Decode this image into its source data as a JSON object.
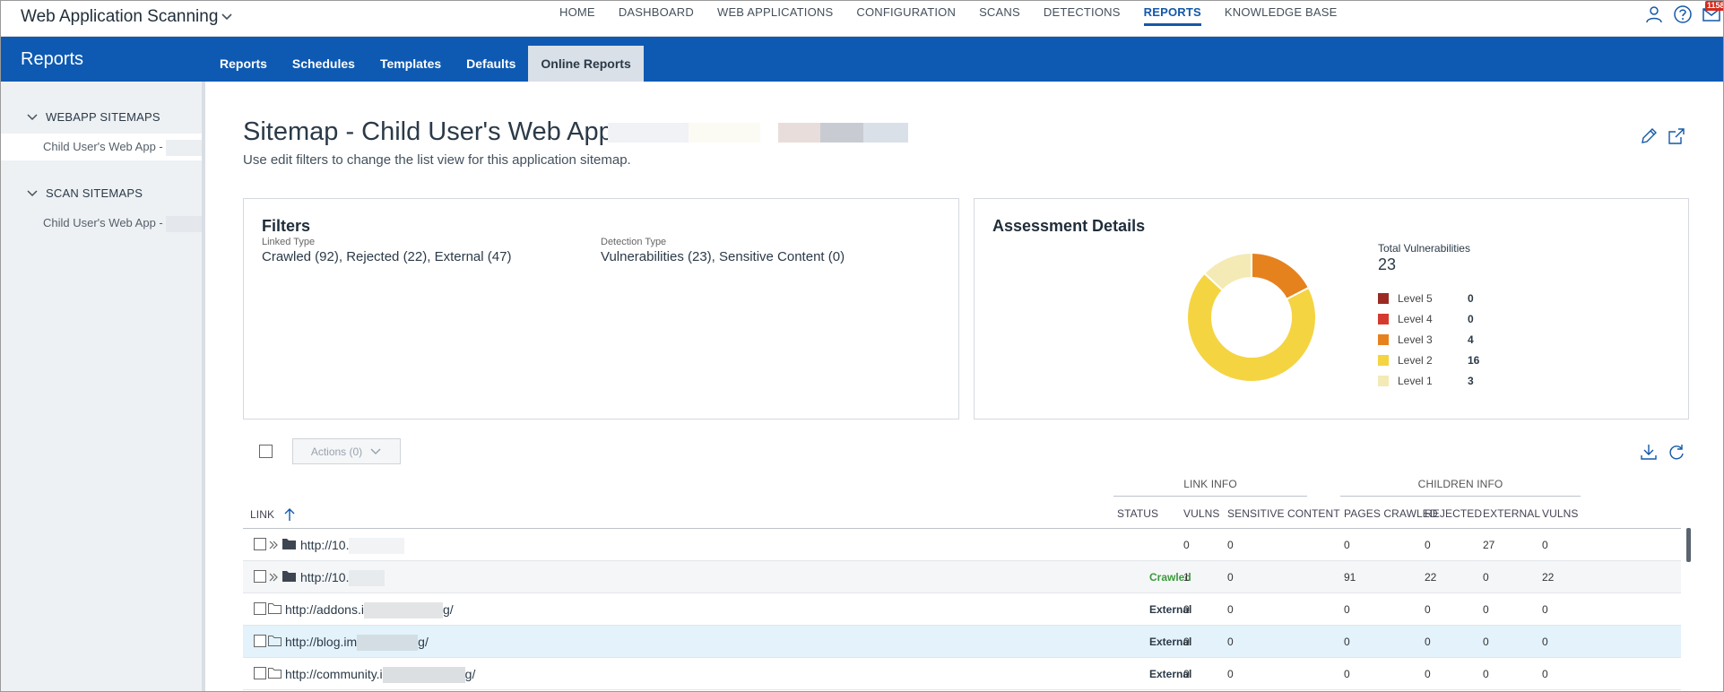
{
  "app": {
    "title": "Web Application Scanning"
  },
  "topnav": [
    {
      "label": "HOME",
      "active": false
    },
    {
      "label": "DASHBOARD",
      "active": false
    },
    {
      "label": "WEB APPLICATIONS",
      "active": false
    },
    {
      "label": "CONFIGURATION",
      "active": false
    },
    {
      "label": "SCANS",
      "active": false
    },
    {
      "label": "DETECTIONS",
      "active": false
    },
    {
      "label": "REPORTS",
      "active": true
    },
    {
      "label": "KNOWLEDGE BASE",
      "active": false
    }
  ],
  "top_icons": {
    "user": "user-icon",
    "help": "help-icon",
    "mail": "mail-icon",
    "mail_badge": "1158"
  },
  "band": {
    "title": "Reports",
    "tabs": [
      "Reports",
      "Schedules",
      "Templates",
      "Defaults",
      "Online Reports"
    ],
    "active_tab": "Online Reports"
  },
  "sidebar": {
    "groups": [
      {
        "label": "WEBAPP SITEMAPS",
        "items": [
          "Child User's Web App -"
        ]
      },
      {
        "label": "SCAN SITEMAPS",
        "items": [
          "Child User's Web App -"
        ]
      }
    ]
  },
  "page": {
    "title": "Sitemap - Child User's Web App -",
    "subtitle": "Use edit filters to change the list view for this application sitemap."
  },
  "filters": {
    "heading": "Filters",
    "linked_type_label": "Linked Type",
    "linked_type_value": "Crawled (92),  Rejected (22),  External (47)",
    "detection_type_label": "Detection Type",
    "detection_type_value": "Vulnerabilities (23), Sensitive Content (0)"
  },
  "assessment": {
    "heading": "Assessment Details",
    "total_label": "Total Vulnerabilities",
    "total_value": "23",
    "levels": [
      {
        "name": "Level 5",
        "value": 0,
        "color": "#9b2b22"
      },
      {
        "name": "Level 4",
        "value": 0,
        "color": "#d53a2e"
      },
      {
        "name": "Level 3",
        "value": 4,
        "color": "#e6821e"
      },
      {
        "name": "Level 2",
        "value": 16,
        "color": "#f5d442"
      },
      {
        "name": "Level 1",
        "value": 3,
        "color": "#f4eab5"
      }
    ]
  },
  "table": {
    "actions_label": "Actions (0)",
    "group_link_info": "LINK INFO",
    "group_children_info": "CHILDREN INFO",
    "columns": {
      "link": "LINK",
      "status": "STATUS",
      "vulns": "VULNS",
      "sensitive": "SENSITIVE CONTENT",
      "pages_crawled": "PAGES CRAWLED",
      "rejected": "REJECTED",
      "external": "EXTERNAL",
      "child_vulns": "VULNS"
    },
    "rows": [
      {
        "link": "http://10.",
        "suffix": "",
        "type": "folder-filled",
        "expandable": true,
        "status": "",
        "vulns": "0",
        "sensitive": "0",
        "pages_crawled": "0",
        "rejected": "0",
        "external": "27",
        "child_vulns": "0"
      },
      {
        "link": "http://10.",
        "suffix": "",
        "type": "folder-filled",
        "expandable": true,
        "status": "Crawled",
        "vulns": "1",
        "sensitive": "0",
        "pages_crawled": "91",
        "rejected": "22",
        "external": "0",
        "child_vulns": "22"
      },
      {
        "link": "http://addons.i",
        "suffix": "g/",
        "type": "folder-outline",
        "expandable": false,
        "status": "External",
        "vulns": "0",
        "sensitive": "0",
        "pages_crawled": "0",
        "rejected": "0",
        "external": "0",
        "child_vulns": "0"
      },
      {
        "link": "http://blog.im",
        "suffix": "g/",
        "type": "folder-outline",
        "expandable": false,
        "status": "External",
        "vulns": "0",
        "sensitive": "0",
        "pages_crawled": "0",
        "rejected": "0",
        "external": "0",
        "child_vulns": "0"
      },
      {
        "link": "http://community.i",
        "suffix": "g/",
        "type": "folder-outline",
        "expandable": false,
        "status": "External",
        "vulns": "0",
        "sensitive": "0",
        "pages_crawled": "0",
        "rejected": "0",
        "external": "0",
        "child_vulns": "0"
      }
    ]
  }
}
